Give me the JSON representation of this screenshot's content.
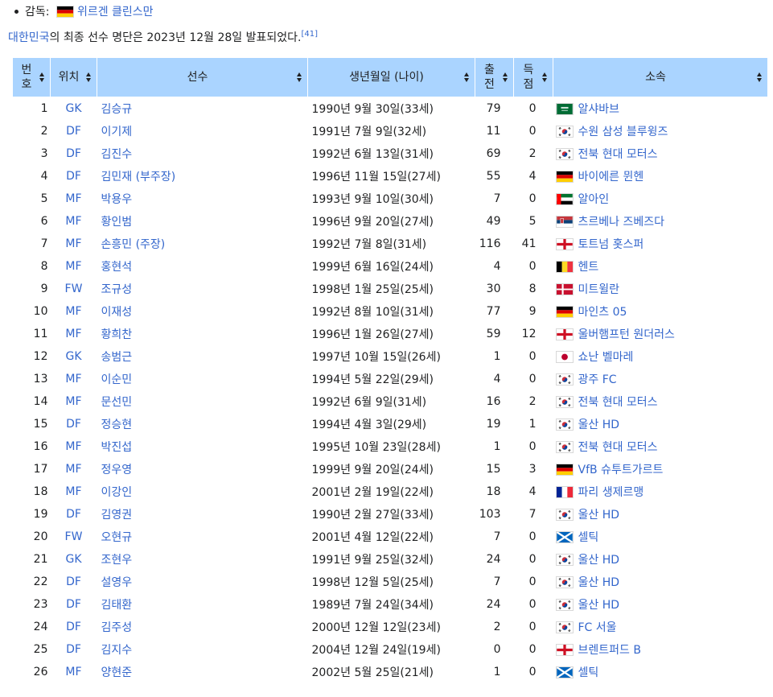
{
  "coach": {
    "label": "감독:",
    "name": "위르겐 클린스만",
    "flag": "germany"
  },
  "intro": {
    "country_link": "대한민국",
    "text": "의 최종 선수 명단은 2023년 12월 28일 발표되었다.",
    "ref": "[41]"
  },
  "headers": {
    "no": "번호",
    "pos": "위치",
    "name": "선수",
    "dob": "생년월일 (나이)",
    "caps": "출전",
    "goals": "득점",
    "club": "소속"
  },
  "players": [
    {
      "no": "1",
      "pos": "GK",
      "name": "김승규",
      "dob": "1990년 9월 30일(33세)",
      "caps": "79",
      "goals": "0",
      "flag": "saudi",
      "club": "알샤바브"
    },
    {
      "no": "2",
      "pos": "DF",
      "name": "이기제",
      "dob": "1991년 7월 9일(32세)",
      "caps": "11",
      "goals": "0",
      "flag": "korea",
      "club": "수원 삼성 블루윙즈"
    },
    {
      "no": "3",
      "pos": "DF",
      "name": "김진수",
      "dob": "1992년 6월 13일(31세)",
      "caps": "69",
      "goals": "2",
      "flag": "korea",
      "club": "전북 현대 모터스"
    },
    {
      "no": "4",
      "pos": "DF",
      "name": "김민재 (부주장)",
      "dob": "1996년 11월 15일(27세)",
      "caps": "55",
      "goals": "4",
      "flag": "germany",
      "club": "바이에른 뮌헨"
    },
    {
      "no": "5",
      "pos": "MF",
      "name": "박용우",
      "dob": "1993년 9월 10일(30세)",
      "caps": "7",
      "goals": "0",
      "flag": "uae",
      "club": "알아인"
    },
    {
      "no": "6",
      "pos": "MF",
      "name": "황인범",
      "dob": "1996년 9월 20일(27세)",
      "caps": "49",
      "goals": "5",
      "flag": "serbia",
      "club": "츠르베나 즈베즈다"
    },
    {
      "no": "7",
      "pos": "MF",
      "name": "손흥민 (주장)",
      "dob": "1992년 7월 8일(31세)",
      "caps": "116",
      "goals": "41",
      "flag": "england",
      "club": "토트넘 홋스퍼"
    },
    {
      "no": "8",
      "pos": "MF",
      "name": "홍현석",
      "dob": "1999년 6월 16일(24세)",
      "caps": "4",
      "goals": "0",
      "flag": "belgium",
      "club": "헨트"
    },
    {
      "no": "9",
      "pos": "FW",
      "name": "조규성",
      "dob": "1998년 1월 25일(25세)",
      "caps": "30",
      "goals": "8",
      "flag": "denmark",
      "club": "미트윌란"
    },
    {
      "no": "10",
      "pos": "MF",
      "name": "이재성",
      "dob": "1992년 8월 10일(31세)",
      "caps": "77",
      "goals": "9",
      "flag": "germany",
      "club": "마인츠 05"
    },
    {
      "no": "11",
      "pos": "MF",
      "name": "황희찬",
      "dob": "1996년 1월 26일(27세)",
      "caps": "59",
      "goals": "12",
      "flag": "england",
      "club": "울버햄프턴 원더러스"
    },
    {
      "no": "12",
      "pos": "GK",
      "name": "송범근",
      "dob": "1997년 10월 15일(26세)",
      "caps": "1",
      "goals": "0",
      "flag": "japan",
      "club": "쇼난 벨마레"
    },
    {
      "no": "13",
      "pos": "MF",
      "name": "이순민",
      "dob": "1994년 5월 22일(29세)",
      "caps": "4",
      "goals": "0",
      "flag": "korea",
      "club": "광주 FC"
    },
    {
      "no": "14",
      "pos": "MF",
      "name": "문선민",
      "dob": "1992년 6월 9일(31세)",
      "caps": "16",
      "goals": "2",
      "flag": "korea",
      "club": "전북 현대 모터스"
    },
    {
      "no": "15",
      "pos": "DF",
      "name": "정승현",
      "dob": "1994년 4월 3일(29세)",
      "caps": "19",
      "goals": "1",
      "flag": "korea",
      "club": "울산 HD"
    },
    {
      "no": "16",
      "pos": "MF",
      "name": "박진섭",
      "dob": "1995년 10월 23일(28세)",
      "caps": "1",
      "goals": "0",
      "flag": "korea",
      "club": "전북 현대 모터스"
    },
    {
      "no": "17",
      "pos": "MF",
      "name": "정우영",
      "dob": "1999년 9월 20일(24세)",
      "caps": "15",
      "goals": "3",
      "flag": "germany",
      "club": "VfB 슈투트가르트"
    },
    {
      "no": "18",
      "pos": "MF",
      "name": "이강인",
      "dob": "2001년 2월 19일(22세)",
      "caps": "18",
      "goals": "4",
      "flag": "france",
      "club": "파리 생제르맹"
    },
    {
      "no": "19",
      "pos": "DF",
      "name": "김영권",
      "dob": "1990년 2월 27일(33세)",
      "caps": "103",
      "goals": "7",
      "flag": "korea",
      "club": "울산 HD"
    },
    {
      "no": "20",
      "pos": "FW",
      "name": "오현규",
      "dob": "2001년 4월 12일(22세)",
      "caps": "7",
      "goals": "0",
      "flag": "scotland",
      "club": "셀틱"
    },
    {
      "no": "21",
      "pos": "GK",
      "name": "조현우",
      "dob": "1991년 9월 25일(32세)",
      "caps": "24",
      "goals": "0",
      "flag": "korea",
      "club": "울산 HD"
    },
    {
      "no": "22",
      "pos": "DF",
      "name": "설영우",
      "dob": "1998년 12월 5일(25세)",
      "caps": "7",
      "goals": "0",
      "flag": "korea",
      "club": "울산 HD"
    },
    {
      "no": "23",
      "pos": "DF",
      "name": "김태환",
      "dob": "1989년 7월 24일(34세)",
      "caps": "24",
      "goals": "0",
      "flag": "korea",
      "club": "울산 HD"
    },
    {
      "no": "24",
      "pos": "DF",
      "name": "김주성",
      "dob": "2000년 12월 12일(23세)",
      "caps": "2",
      "goals": "0",
      "flag": "korea",
      "club": "FC 서울"
    },
    {
      "no": "25",
      "pos": "DF",
      "name": "김지수",
      "dob": "2004년 12월 24일(19세)",
      "caps": "0",
      "goals": "0",
      "flag": "england",
      "club": "브렌트퍼드 B"
    },
    {
      "no": "26",
      "pos": "MF",
      "name": "양현준",
      "dob": "2002년 5월 25일(21세)",
      "caps": "1",
      "goals": "0",
      "flag": "scotland",
      "club": "셀틱"
    }
  ],
  "colors": {
    "header_bg": "#aad4ff",
    "link": "#3366cc",
    "text": "#202122"
  }
}
